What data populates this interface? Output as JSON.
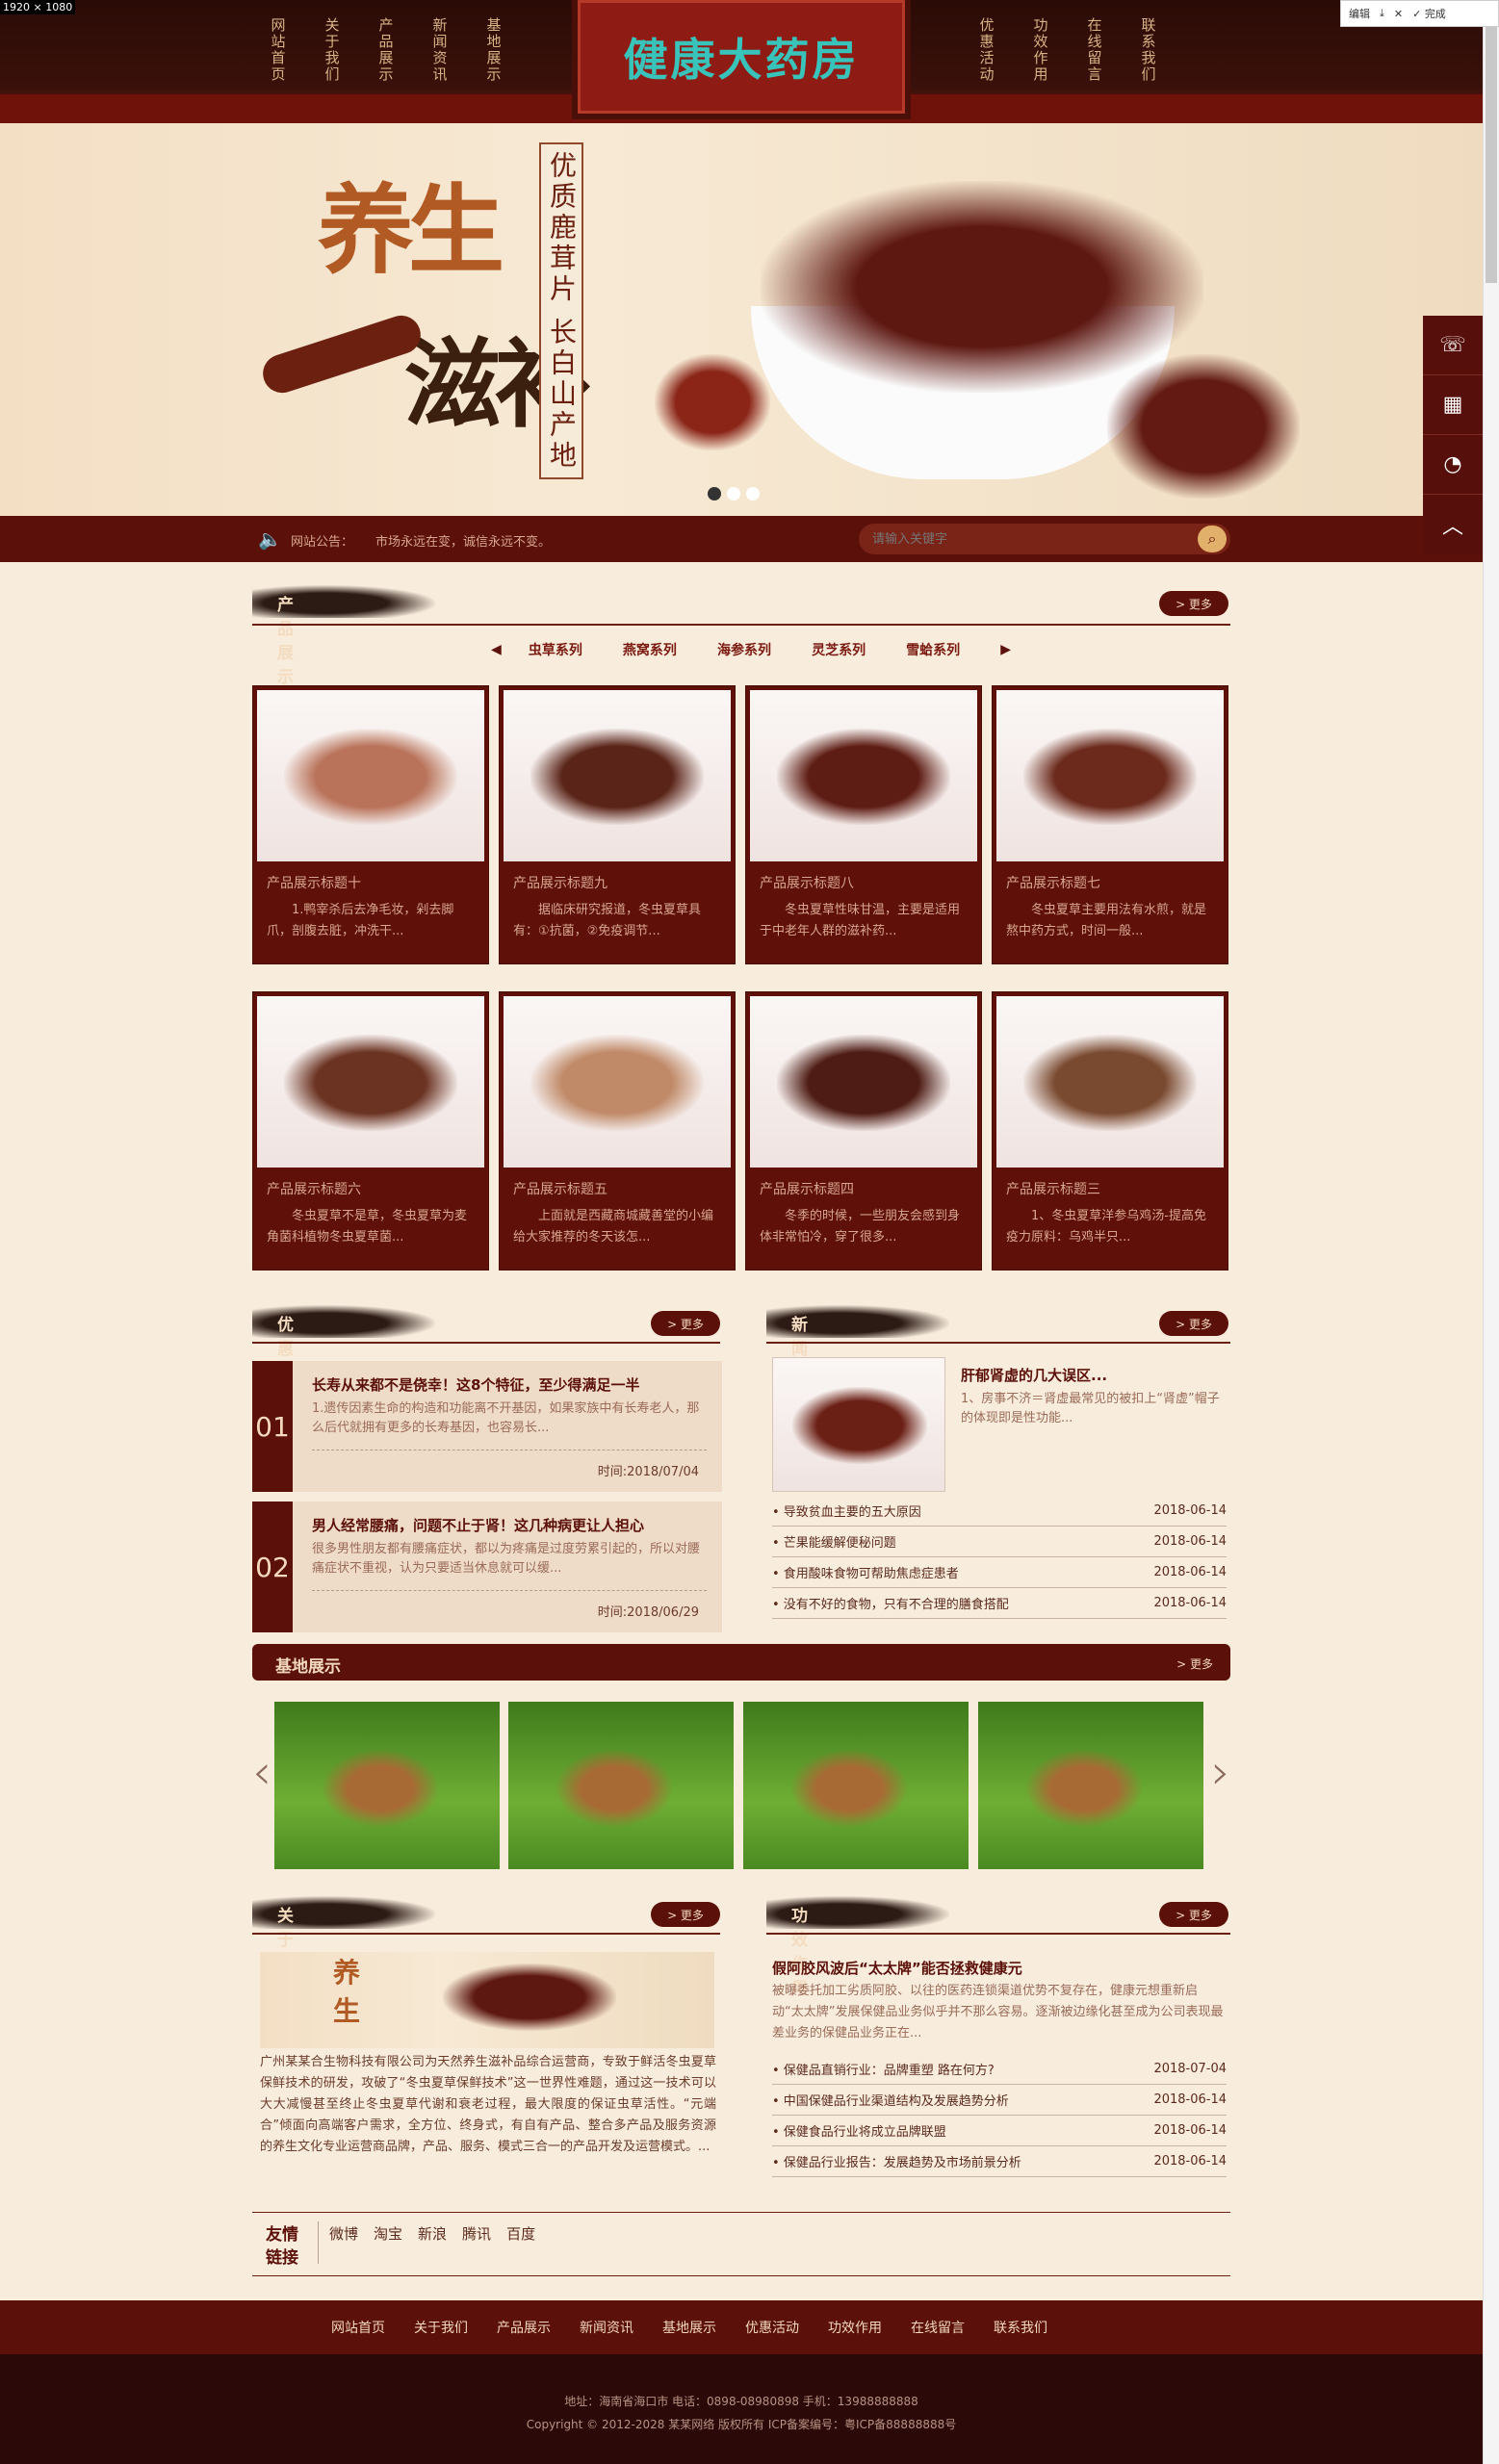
{
  "capture_label": "1920 × 1080",
  "toolbar": {
    "edit": "编辑",
    "done": "完成"
  },
  "nav_left": [
    "网站首页",
    "关于我们",
    "产品展示",
    "新闻资讯",
    "基地展示"
  ],
  "nav_right": [
    "优惠活动",
    "功效作用",
    "在线留言",
    "联系我们"
  ],
  "logo": "健康大药房",
  "banner": {
    "big1": "养生",
    "big2": "滋补",
    "vertical": "优质鹿茸片 长白山产地"
  },
  "notice": {
    "label": "网站公告：",
    "text": "市场永远在变，诚信永远不变。",
    "search_placeholder": "请输入关键字"
  },
  "sections": {
    "products": "产品展示",
    "promo": "优惠活动",
    "news": "新闻资讯",
    "base": "基地展示",
    "about": "关于我们",
    "effect": "功效作用",
    "more": "> 更多"
  },
  "product_tabs": [
    "虫草系列",
    "燕窝系列",
    "海参系列",
    "灵芝系列",
    "雪蛤系列"
  ],
  "products": [
    {
      "title": "产品展示标题十",
      "desc": "1.鸭宰杀后去净毛妆，剁去脚爪，剖腹去脏，冲洗干..."
    },
    {
      "title": "产品展示标题九",
      "desc": "据临床研究报道，冬虫夏草具有：①抗菌，②免疫调节..."
    },
    {
      "title": "产品展示标题八",
      "desc": "冬虫夏草性味甘温，主要是适用于中老年人群的滋补药..."
    },
    {
      "title": "产品展示标题七",
      "desc": "冬虫夏草主要用法有水煎，就是熬中药方式，时间一般..."
    },
    {
      "title": "产品展示标题六",
      "desc": "冬虫夏草不是草，冬虫夏草为麦角菌科植物冬虫夏草菌..."
    },
    {
      "title": "产品展示标题五",
      "desc": "上面就是西藏商城藏善堂的小编给大家推荐的冬天该怎..."
    },
    {
      "title": "产品展示标题四",
      "desc": "冬季的时候，一些朋友会感到身体非常怕冷，穿了很多..."
    },
    {
      "title": "产品展示标题三",
      "desc": "1、冬虫夏草洋参乌鸡汤-提高免疫力原料：乌鸡半只..."
    }
  ],
  "promos": [
    {
      "num": "01",
      "title": "长寿从来都不是侥幸！这8个特征，至少得满足一半",
      "desc": "1.遗传因素生命的构造和功能离不开基因，如果家族中有长寿老人，那么后代就拥有更多的长寿基因，也容易长...",
      "time": "时间:2018/07/04"
    },
    {
      "num": "02",
      "title": "男人经常腰痛，问题不止于肾！这几种病更让人担心",
      "desc": "很多男性朋友都有腰痛症状，都以为疼痛是过度劳累引起的，所以对腰痛症状不重视，认为只要适当休息就可以缓...",
      "time": "时间:2018/06/29"
    }
  ],
  "news_top": {
    "title": "肝郁肾虚的几大误区...",
    "desc": "1、房事不济＝肾虚最常见的被扣上“肾虚”帽子的体现即是性功能..."
  },
  "news_list": [
    {
      "t": "• 导致贫血主要的五大原因",
      "d": "2018-06-14"
    },
    {
      "t": "• 芒果能缓解便秘问题",
      "d": "2018-06-14"
    },
    {
      "t": "• 食用酸味食物可帮助焦虑症患者",
      "d": "2018-06-14"
    },
    {
      "t": "• 没有不好的食物，只有不合理的膳食搭配",
      "d": "2018-06-14"
    }
  ],
  "about_text": "广州某某合生物科技有限公司为天然养生滋补品综合运营商，专致于鲜活冬虫夏草保鲜技术的研发，攻破了“冬虫夏草保鲜技术”这一世界性难题，通过这一技术可以大大减慢甚至终止冬虫夏草代谢和衰老过程，最大限度的保证虫草活性。“元端合”倾面向高端客户需求，全方位、终身式，有自有产品、整合多产品及服务资源的养生文化专业运营商品牌，产品、服务、模式三合一的产品开发及运营模式。...",
  "effect_top": {
    "title": "假阿胶风波后“太太牌”能否拯救健康元",
    "desc": "被曝委托加工劣质阿胶、以往的医药连锁渠道优势不复存在，健康元想重新启动“太太牌”发展保健品业务似乎并不那么容易。逐渐被边缘化甚至成为公司表现最差业务的保健品业务正在..."
  },
  "effect_list": [
    {
      "t": "• 保健品直销行业：品牌重塑 路在何方?",
      "d": "2018-07-04"
    },
    {
      "t": "• 中国保健品行业渠道结构及发展趋势分析",
      "d": "2018-06-14"
    },
    {
      "t": "• 保健食品行业将成立品牌联盟",
      "d": "2018-06-14"
    },
    {
      "t": "• 保健品行业报告：发展趋势及市场前景分析",
      "d": "2018-06-14"
    }
  ],
  "links": {
    "label1": "友情",
    "label2": "链接",
    "items": [
      "微博",
      "淘宝",
      "新浪",
      "腾讯",
      "百度"
    ]
  },
  "footer_nav": [
    "网站首页",
    "关于我们",
    "产品展示",
    "新闻资讯",
    "基地展示",
    "优惠活动",
    "功效作用",
    "在线留言",
    "联系我们"
  ],
  "footer_info1": "地址：海南省海口市      电话：0898-08980898      手机：13988888888",
  "footer_info2": "Copyright © 2012-2028 某某网络 版权所有      ICP备案编号：粤ICP备88888888号"
}
